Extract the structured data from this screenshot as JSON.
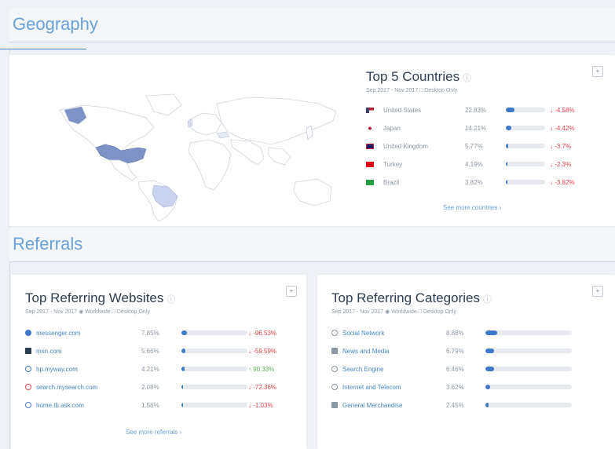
{
  "geography": {
    "section_title": "Geography",
    "panel_title": "Top 5 Countries",
    "subtitle": "Sep 2017 - Nov 2017  □ Desktop Only",
    "see_more": "See more countries ›",
    "countries": [
      {
        "name": "United States",
        "pct": "22.83%",
        "share": 0.2283,
        "change": "↓ -4.58%",
        "dir": "down",
        "flag": "us-flag"
      },
      {
        "name": "Japan",
        "pct": "14.21%",
        "share": 0.1421,
        "change": "↓ -4.42%",
        "dir": "down",
        "flag": "japan-flag"
      },
      {
        "name": "United Kingdom",
        "pct": "5.77%",
        "share": 0.0577,
        "change": "↓ -3.7%",
        "dir": "down",
        "flag": "uk-flag"
      },
      {
        "name": "Turkey",
        "pct": "4.19%",
        "share": 0.0419,
        "change": "↓ -2.3%",
        "dir": "down",
        "flag": "turkey-flag"
      },
      {
        "name": "Brazil",
        "pct": "3.82%",
        "share": 0.0382,
        "change": "↓ -3.82%",
        "dir": "down",
        "flag": "brazil-flag"
      }
    ]
  },
  "referrals": {
    "section_title": "Referrals",
    "websites": {
      "title": "Top Referring Websites",
      "subtitle": "Sep 2017 - Nov 2017  ◉ Worldwide  □ Desktop Only",
      "see_more": "See more referrals ›",
      "items": [
        {
          "name": "messenger.com",
          "pct": "7.85%",
          "share": 0.0785,
          "change": "↓ -96.53%",
          "dir": "down",
          "icon": "messenger-icon"
        },
        {
          "name": "msn.com",
          "pct": "5.66%",
          "share": 0.0566,
          "change": "↓ -59.59%",
          "dir": "down",
          "icon": "msn-icon"
        },
        {
          "name": "hp.myway.com",
          "pct": "4.21%",
          "share": 0.0421,
          "change": "↑ 90.33%",
          "dir": "up",
          "icon": "myway-icon"
        },
        {
          "name": "search.mysearch.com",
          "pct": "2.08%",
          "share": 0.0208,
          "change": "↓ -72.36%",
          "dir": "down",
          "icon": "mysearch-icon"
        },
        {
          "name": "home.tb.ask.com",
          "pct": "1.56%",
          "share": 0.0156,
          "change": "↓ -1.03%",
          "dir": "down",
          "icon": "ask-icon"
        }
      ]
    },
    "categories": {
      "title": "Top Referring Categories",
      "subtitle": "Sep 2017 - Nov 2017  ◉ Worldwide  □ Desktop Only",
      "items": [
        {
          "name": "Social Network",
          "pct": "8.88%",
          "share": 0.0888,
          "icon": "social-network-icon"
        },
        {
          "name": "News and Media",
          "pct": "6.79%",
          "share": 0.0679,
          "icon": "news-media-icon"
        },
        {
          "name": "Search Engine",
          "pct": "6.46%",
          "share": 0.0646,
          "icon": "search-engine-icon"
        },
        {
          "name": "Internet and Telecom",
          "pct": "3.62%",
          "share": 0.0362,
          "icon": "internet-telecom-icon"
        },
        {
          "name": "General Merchandise",
          "pct": "2.45%",
          "share": 0.0245,
          "icon": "merchandise-icon"
        }
      ]
    }
  },
  "colors": {
    "accent": "#3f78c8",
    "heading": "#6aa1d8",
    "negative": "#e8424a",
    "positive": "#5db55d",
    "map_highlight": "#7f92c8",
    "map_light": "#c9d3ee"
  }
}
